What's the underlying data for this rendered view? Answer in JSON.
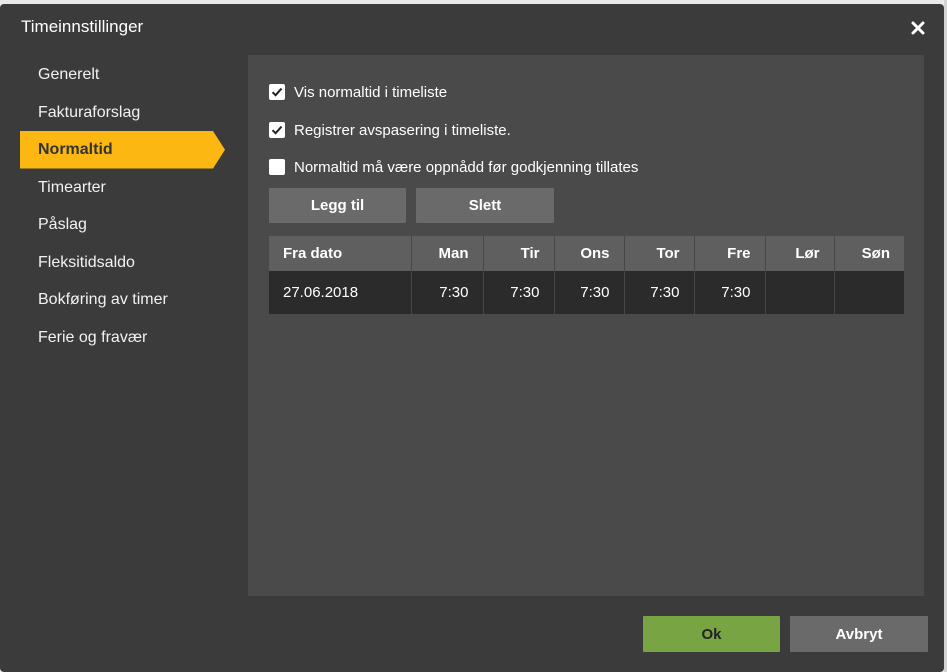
{
  "dialog": {
    "title": "Timeinnstillinger",
    "close_icon": "close-icon"
  },
  "nav": {
    "items": [
      {
        "label": "Generelt",
        "active": false
      },
      {
        "label": "Fakturaforslag",
        "active": false
      },
      {
        "label": "Normaltid",
        "active": true
      },
      {
        "label": "Timearter",
        "active": false
      },
      {
        "label": "Påslag",
        "active": false
      },
      {
        "label": "Fleksitidsaldo",
        "active": false
      },
      {
        "label": "Bokføring av timer",
        "active": false
      },
      {
        "label": "Ferie og fravær",
        "active": false
      }
    ],
    "active_color": "#fcb712"
  },
  "settings": {
    "checkboxes": [
      {
        "label": "Vis normaltid i timeliste",
        "checked": true
      },
      {
        "label": "Registrer avspasering i timeliste.",
        "checked": true
      },
      {
        "label": "Normaltid må være oppnådd før godkjenning tillates",
        "checked": false
      }
    ],
    "add_label": "Legg til",
    "delete_label": "Slett"
  },
  "table": {
    "headers": [
      "Fra dato",
      "Man",
      "Tir",
      "Ons",
      "Tor",
      "Fre",
      "Lør",
      "Søn"
    ],
    "rows": [
      [
        "27.06.2018",
        "7:30",
        "7:30",
        "7:30",
        "7:30",
        "7:30",
        "",
        ""
      ]
    ]
  },
  "footer": {
    "ok_label": "Ok",
    "cancel_label": "Avbryt",
    "ok_color": "#79a443",
    "cancel_color": "#6a6a6a"
  }
}
